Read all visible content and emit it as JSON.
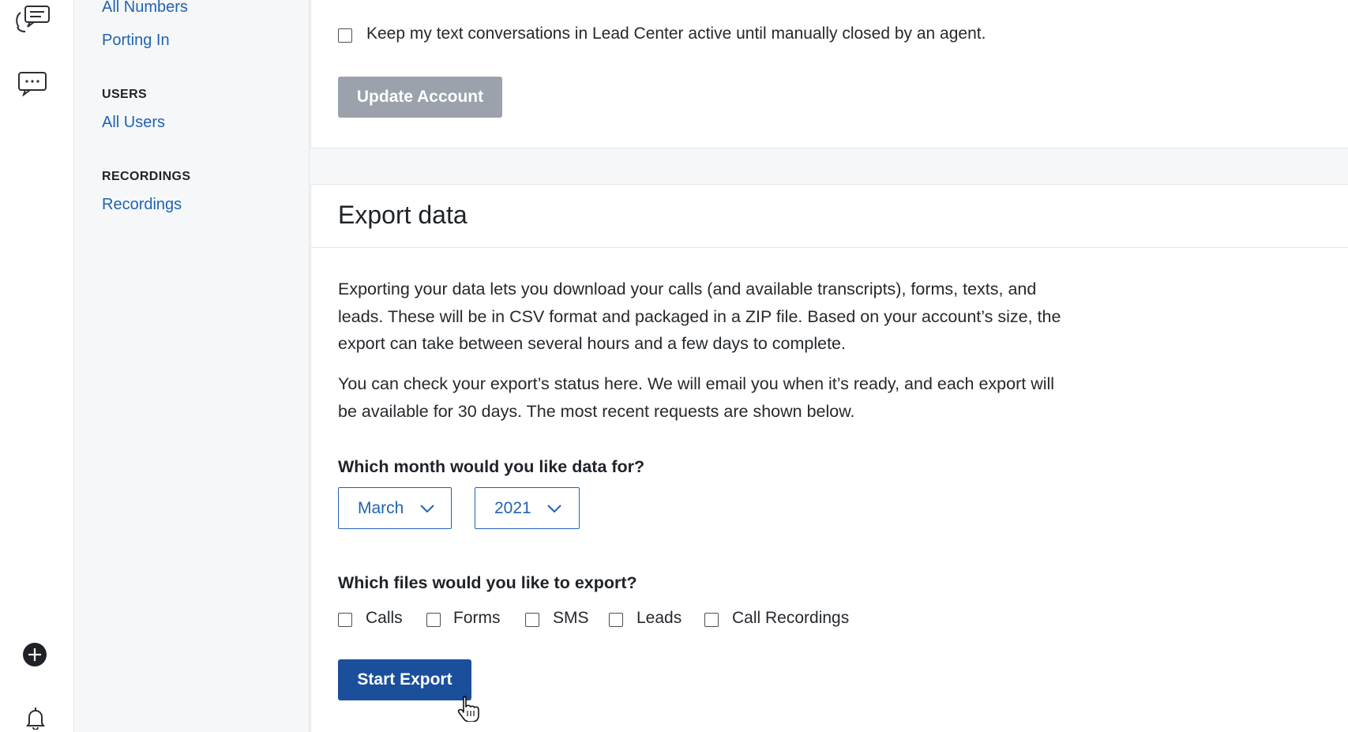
{
  "nav": {
    "all_numbers": "All Numbers",
    "porting_in": "Porting In",
    "users_heading": "USERS",
    "all_users": "All Users",
    "recordings_heading": "RECORDINGS",
    "recordings": "Recordings"
  },
  "account": {
    "keep_active_label": "Keep my text conversations in Lead Center active until manually closed by an agent.",
    "keep_active_checked": false,
    "update_button": "Update Account"
  },
  "export": {
    "title": "Export data",
    "paragraph_1": "Exporting your data lets you download your calls (and available transcripts), forms, texts, and leads. These will be in CSV format and packaged in a ZIP file. Based on your account’s size, the export can take between several hours and a few days to complete.",
    "paragraph_2": "You can check your export’s status here. We will email you when it’s ready, and each export will be available for 30 days. The most recent requests are shown below.",
    "month_question": "Which month would you like data for?",
    "month_value": "March",
    "year_value": "2021",
    "files_question": "Which files would you like to export?",
    "file_options": [
      {
        "label": "Calls",
        "checked": false
      },
      {
        "label": "Forms",
        "checked": false
      },
      {
        "label": "SMS",
        "checked": false
      },
      {
        "label": "Leads",
        "checked": false
      },
      {
        "label": "Call Recordings",
        "checked": false
      }
    ],
    "start_button": "Start Export"
  },
  "colors": {
    "link": "#1f63b4",
    "primary_button": "#1b4f9c",
    "disabled_button": "#9ba2ab"
  },
  "icons": [
    "headset-chat-icon",
    "message-dots-icon",
    "plus-circle-icon",
    "bell-icon",
    "hand-pointer-cursor-icon"
  ]
}
